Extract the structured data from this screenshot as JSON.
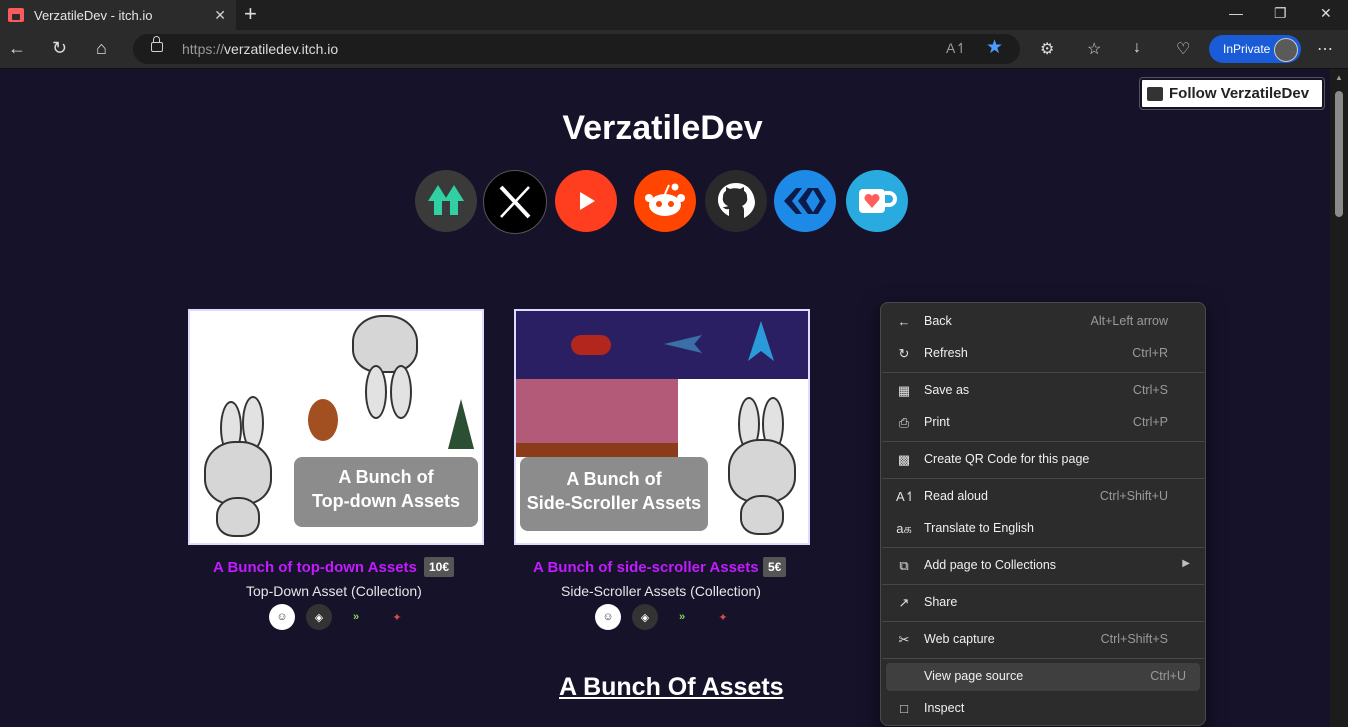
{
  "browser": {
    "tab_title": "VerzatileDev - itch.io",
    "url_proto": "https://",
    "url_host": "verzatiledev.itch.io",
    "inprivate_label": "InPrivate"
  },
  "page": {
    "follow_label": "Follow VerzatileDev",
    "dev_name": "VerzatileDev",
    "social_links": [
      "itch-like-arrow",
      "x",
      "youtube",
      "reddit",
      "github",
      "unknown-kx",
      "ko-fi"
    ],
    "games": [
      {
        "title": "A Bunch of top-down Assets",
        "price": "10€",
        "subtitle": "Top-Down Asset (Collection)",
        "image_label": [
          "A Bunch of",
          "Top-down Assets"
        ]
      },
      {
        "title": "A Bunch of side-scroller Assets",
        "price": "5€",
        "subtitle": "Side-Scroller Assets (Collection)",
        "image_label": [
          "A Bunch of",
          "Side-Scroller Assets"
        ]
      }
    ],
    "section_heading": "A Bunch Of Assets"
  },
  "context_menu": {
    "items": [
      {
        "label": "Back",
        "shortcut": "Alt+Left arrow",
        "icon": "arrow-left-icon"
      },
      {
        "label": "Refresh",
        "shortcut": "Ctrl+R",
        "icon": "refresh-icon"
      },
      {
        "label": "Save as",
        "shortcut": "Ctrl+S",
        "icon": "save-icon"
      },
      {
        "label": "Print",
        "shortcut": "Ctrl+P",
        "icon": "print-icon"
      },
      {
        "label": "Create QR Code for this page",
        "shortcut": "",
        "icon": "qr-icon"
      },
      {
        "label": "Read aloud",
        "shortcut": "Ctrl+Shift+U",
        "icon": "read-aloud-icon"
      },
      {
        "label": "Translate to English",
        "shortcut": "",
        "icon": "translate-icon"
      },
      {
        "label": "Add page to Collections",
        "shortcut": "",
        "icon": "collections-icon"
      },
      {
        "label": "Share",
        "shortcut": "",
        "icon": "share-icon"
      },
      {
        "label": "Web capture",
        "shortcut": "Ctrl+Shift+S",
        "icon": "web-capture-icon"
      },
      {
        "label": "View page source",
        "shortcut": "Ctrl+U",
        "icon": ""
      },
      {
        "label": "Inspect",
        "shortcut": "",
        "icon": "inspect-icon"
      }
    ]
  }
}
